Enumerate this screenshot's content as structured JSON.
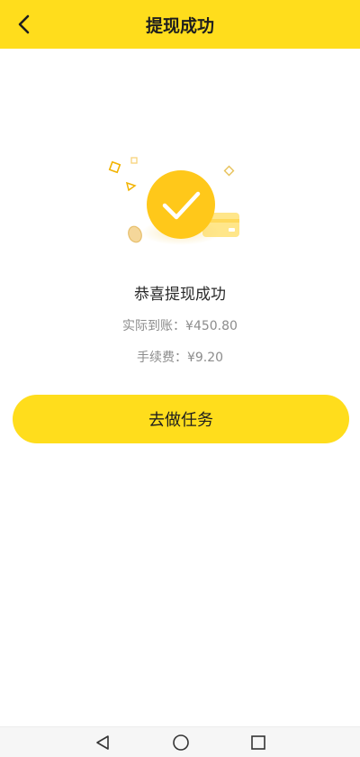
{
  "header": {
    "title": "提现成功",
    "back_icon": "chevron-left-icon"
  },
  "result": {
    "message": "恭喜提现成功",
    "received": "实际到账：¥450.80",
    "fee": "手续费：¥9.20",
    "illustration_icon": "check-circle-icon"
  },
  "action": {
    "button_label": "去做任务"
  },
  "system_nav": {
    "icons": [
      "back-triangle-icon",
      "home-circle-icon",
      "recents-square-icon"
    ]
  },
  "colors": {
    "brand_yellow": "#FFDD1C",
    "check_yellow": "#FFC81A",
    "text_dark": "#1e1e1e",
    "text_gray": "#8c8c8c"
  }
}
